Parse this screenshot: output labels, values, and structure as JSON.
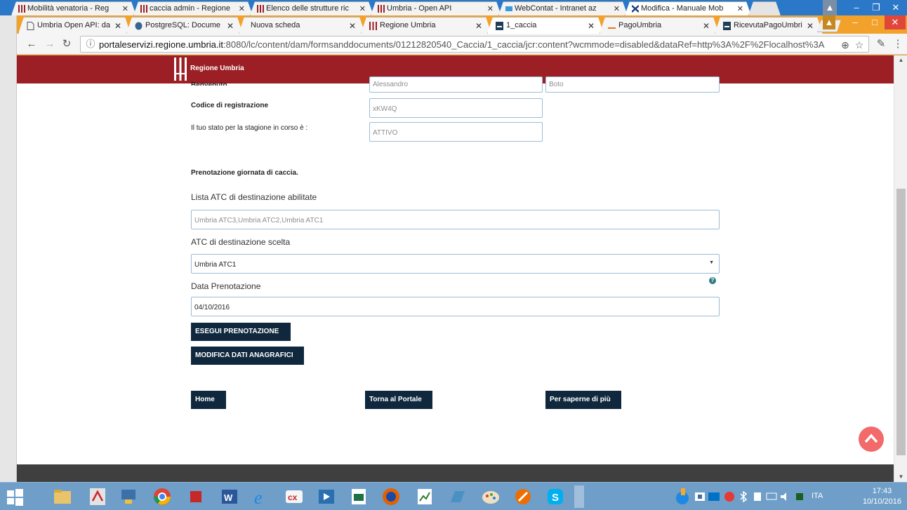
{
  "background_window": {
    "tabs": [
      {
        "label": "Mobilità venatoria - Reg",
        "active": false
      },
      {
        "label": "caccia admin - Regione",
        "active": false
      },
      {
        "label": "Elenco delle strutture ric",
        "active": false
      },
      {
        "label": "Umbria - Open API",
        "active": false
      },
      {
        "label": "WebContat - Intranet az",
        "active": false
      },
      {
        "label": "Modifica - Manuale Mob",
        "active": true
      }
    ]
  },
  "browser": {
    "tabs": [
      {
        "label": "Umbria Open API: da",
        "active": false
      },
      {
        "label": "PostgreSQL: Docume",
        "active": false
      },
      {
        "label": "Nuova scheda",
        "active": false
      },
      {
        "label": "Regione Umbria",
        "active": false
      },
      {
        "label": "1_caccia",
        "active": true
      },
      {
        "label": "PagoUmbria",
        "active": false
      },
      {
        "label": "RicevutaPagoUmbri",
        "active": false
      }
    ],
    "url_host": "portaleservizi.regione.umbria.it",
    "url_rest": ":8080/lc/content/dam/formsanddocuments/01212820540_Caccia/1_caccia/jcr:content?wcmmode=disabled&dataRef=http%3A%2F%2Flocalhost%3A"
  },
  "site": {
    "brand": "Regione Umbria"
  },
  "form": {
    "benvenuto_label": "Benvenuto",
    "first_name": "Alessandro",
    "last_name": "Boto",
    "codice_label": "Codice di registrazione",
    "codice_value": "xKW4Q",
    "stato_label": "Il tuo stato per la stagione in corso è :",
    "stato_value": "ATTIVO",
    "section_title": "Prenotazione giornata di caccia.",
    "atc_list_label": "Lista ATC di destinazione abilitate",
    "atc_list_value": "Umbria ATC3,Umbria ATC2,Umbria ATC1",
    "atc_choice_label": "ATC di destinazione scelta",
    "atc_choice_value": "Umbria ATC1",
    "date_label": "Data Prenotazione",
    "date_value": "04/10/2016",
    "help_glyph": "?",
    "btn_prenota": "ESEGUI PRENOTAZIONE",
    "btn_modifica": "MODIFICA DATI ANAGRAFICI"
  },
  "footer": {
    "home": "Home",
    "portale": "Torna al Portale",
    "saperne": "Per saperne di più"
  },
  "taskbar": {
    "lang": "ITA",
    "time": "17:43",
    "date": "10/10/2016"
  },
  "colors": {
    "header_red": "#9b1f24",
    "button_navy": "#10283d",
    "chrome_orange": "#f2a12a",
    "taskbar_blue": "#6f9ec8"
  }
}
